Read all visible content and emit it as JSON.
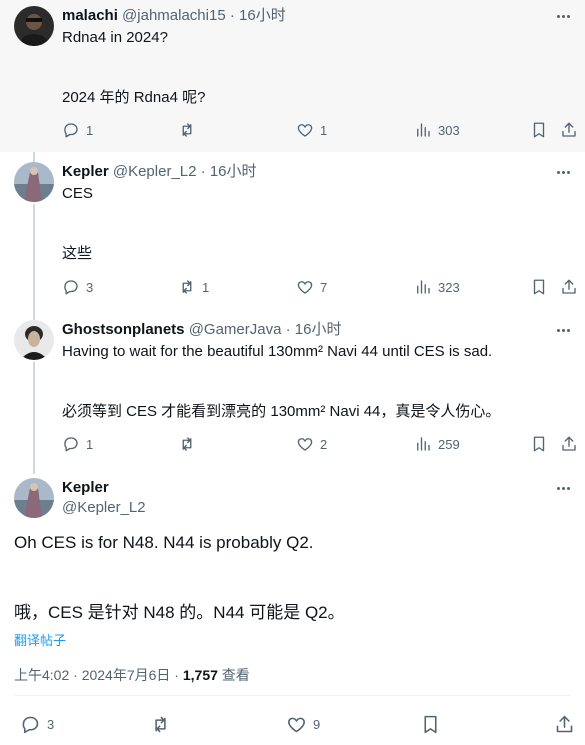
{
  "tweets": [
    {
      "name": "malachi",
      "handle": "@jahmalachi15",
      "time": "16小时",
      "lines": [
        "Rdna4 in 2024?",
        "2024 年的 Rdna4 呢?"
      ],
      "replies": "1",
      "retweets": "",
      "likes": "1",
      "views": "303"
    },
    {
      "name": "Kepler",
      "handle": "@Kepler_L2",
      "time": "16小时",
      "lines": [
        "CES",
        "这些"
      ],
      "replies": "3",
      "retweets": "1",
      "likes": "7",
      "views": "323"
    },
    {
      "name": "Ghostsonplanets",
      "handle": "@GamerJava",
      "time": "16小时",
      "lines": [
        "Having to wait for the beautiful 130mm² Navi 44 until CES is sad.",
        "必须等到 CES 才能看到漂亮的 130mm² Navi 44，真是令人伤心。"
      ],
      "replies": "1",
      "retweets": "",
      "likes": "2",
      "views": "259"
    }
  ],
  "main": {
    "name": "Kepler",
    "handle": "@Kepler_L2",
    "text_en": "Oh CES is for N48. N44 is probably Q2.",
    "text_zh": "哦，CES 是针对 N48 的。N44 可能是 Q2。",
    "translate_label": "翻译帖子",
    "time": "上午4:02 · 2024年7月6日 · ",
    "views_count": "1,757",
    "views_label": " 查看",
    "replies": "3",
    "retweets": "",
    "likes": "9"
  },
  "icons": {
    "reply": "reply-icon",
    "retweet": "retweet-icon",
    "like": "heart-icon",
    "views": "views-chart-icon",
    "bookmark": "bookmark-icon",
    "share": "share-icon",
    "more": "more-dots-icon"
  },
  "colors": {
    "text": "#0f1419",
    "secondary": "#536471",
    "link": "#1d9bf0",
    "thread_line": "#cfd9de",
    "highlight_bg": "#f7f7f7"
  }
}
